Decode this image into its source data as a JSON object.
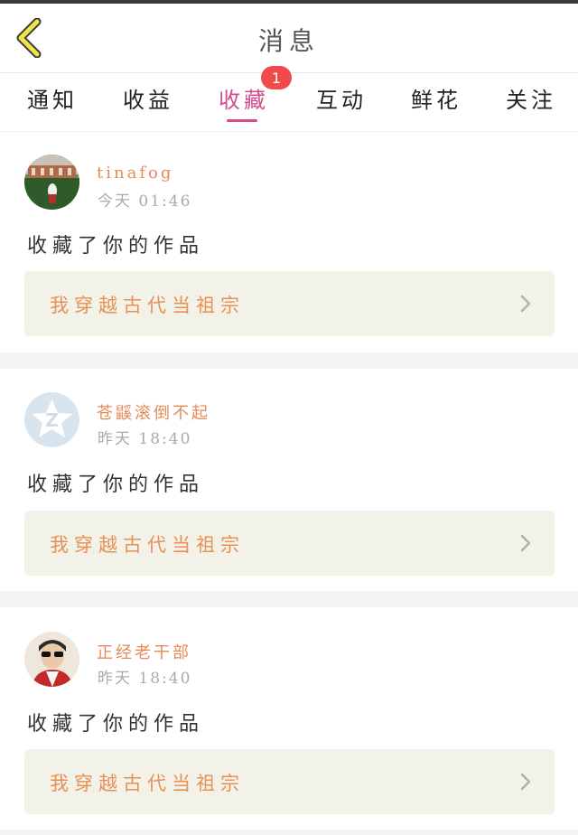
{
  "header": {
    "title": "消息",
    "back_icon": "chevron-left-icon"
  },
  "tabs": [
    {
      "label": "通知",
      "active": false
    },
    {
      "label": "收益",
      "active": false
    },
    {
      "label": "收藏",
      "active": true,
      "badge": "1"
    },
    {
      "label": "互动",
      "active": false
    },
    {
      "label": "鲜花",
      "active": false
    },
    {
      "label": "关注",
      "active": false
    }
  ],
  "colors": {
    "accent": "#d24b8e",
    "username": "#e58b58",
    "work_title": "#e99055",
    "badge": "#f04a4a"
  },
  "messages": [
    {
      "username": "tinafog",
      "time": "今天 01:46",
      "action": "收藏了你的作品",
      "work_title": "我穿越古代当祖宗"
    },
    {
      "username": "苍鼷滚倒不起",
      "time": "昨天 18:40",
      "action": "收藏了你的作品",
      "work_title": "我穿越古代当祖宗"
    },
    {
      "username": "正经老干部",
      "time": "昨天 18:40",
      "action": "收藏了你的作品",
      "work_title": "我穿越古代当祖宗"
    }
  ]
}
